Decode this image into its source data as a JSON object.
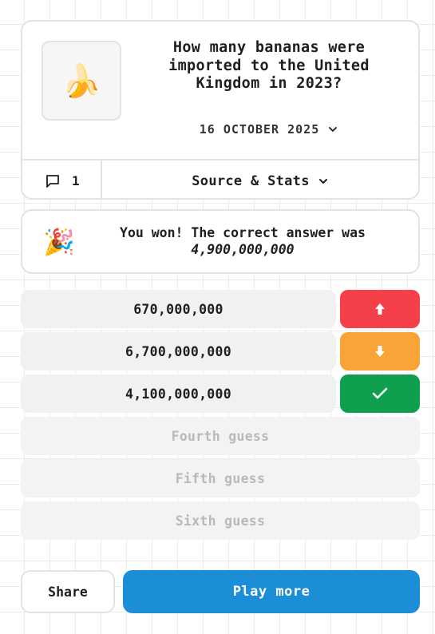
{
  "question": {
    "thumbnail_icon": "banana-icon",
    "thumbnail_glyph": "🍌",
    "text": "How many bananas were imported to the United Kingdom in 2023?",
    "date": "16 OCTOBER 2025"
  },
  "footer_bar": {
    "comment_count": "1",
    "stats_label": "Source & Stats"
  },
  "result": {
    "icon": "party-popper-icon",
    "glyph": "🎉",
    "message": "You won! The correct answer was",
    "answer": "4,900,000,000"
  },
  "guesses": [
    {
      "value": "670,000,000",
      "hint": "higher",
      "hint_color": "#f5404a"
    },
    {
      "value": "6,700,000,000",
      "hint": "lower",
      "hint_color": "#f8a436"
    },
    {
      "value": "4,100,000,000",
      "hint": "correct",
      "hint_color": "#0e9f4f"
    }
  ],
  "empty_slots": [
    "Fourth guess",
    "Fifth guess",
    "Sixth guess"
  ],
  "actions": {
    "share_label": "Share",
    "play_label": "Play more"
  }
}
